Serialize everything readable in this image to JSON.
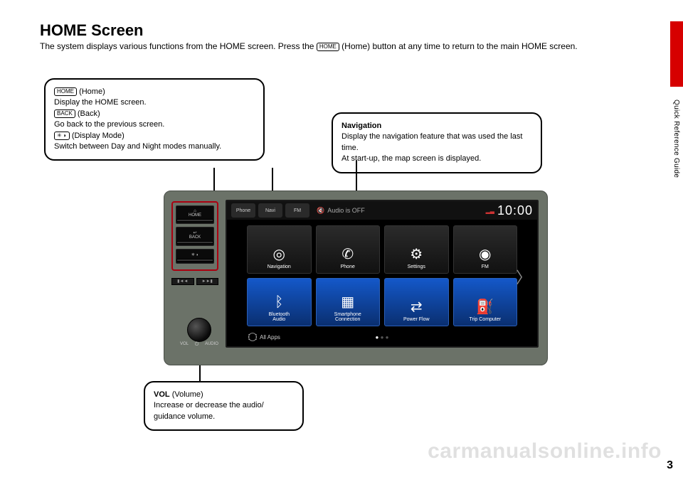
{
  "page": {
    "title": "HOME Screen",
    "subtitle_pre": "The system displays various functions from the HOME screen. Press the ",
    "subtitle_icon": "HOME",
    "subtitle_post": " (Home) button at any time to return to the main HOME screen.",
    "side_label": "Quick Reference Guide",
    "page_number": "3",
    "watermark": "carmanualsonline.info"
  },
  "callouts": {
    "buttons": {
      "home_icon": "HOME",
      "home_label": " (Home)",
      "home_desc": "Display the HOME screen.",
      "back_icon": "BACK",
      "back_label": " (Back)",
      "back_desc": "Go back to the previous screen.",
      "disp_icon": "✳ ◗",
      "disp_label": " (Display Mode)",
      "disp_desc": "Switch between Day and Night modes manually."
    },
    "nav": {
      "title": "Navigation",
      "line1": "Display the navigation feature that was used the last time.",
      "line2": "At start-up, the map screen is displayed."
    },
    "vol": {
      "title": "VOL",
      "title_sub": " (Volume)",
      "desc": "Increase or decrease the audio/ guidance volume."
    }
  },
  "unit": {
    "hw_home": "HOME",
    "hw_back": "BACK",
    "hw_disp": "✳ ◗",
    "hw_prev": "▮◄◄",
    "hw_next": "►►▮",
    "hw_vol": "VOL",
    "hw_audio": "AUDIO"
  },
  "display": {
    "top_tabs": {
      "phone": "Phone",
      "navi": "Navi",
      "fm": "FM"
    },
    "audio_off": "Audio is OFF",
    "clock": "10:00",
    "tiles": [
      {
        "label": "Navigation",
        "icon": "◎",
        "cls": "t-dark"
      },
      {
        "label": "Phone",
        "icon": "✆",
        "cls": "t-dark"
      },
      {
        "label": "Settings",
        "icon": "⚙",
        "cls": "t-dark"
      },
      {
        "label": "FM",
        "icon": "◉",
        "cls": "t-dark"
      },
      {
        "label": "Bluetooth\nAudio",
        "icon": "ᛒ",
        "cls": "t-blue"
      },
      {
        "label": "Smartphone\nConnection",
        "icon": "▦",
        "cls": "t-blue"
      },
      {
        "label": "Power Flow",
        "icon": "⇄",
        "cls": "t-blue"
      },
      {
        "label": "Trip Computer",
        "icon": "⛽",
        "cls": "t-blue"
      }
    ],
    "all_apps": "All Apps"
  }
}
